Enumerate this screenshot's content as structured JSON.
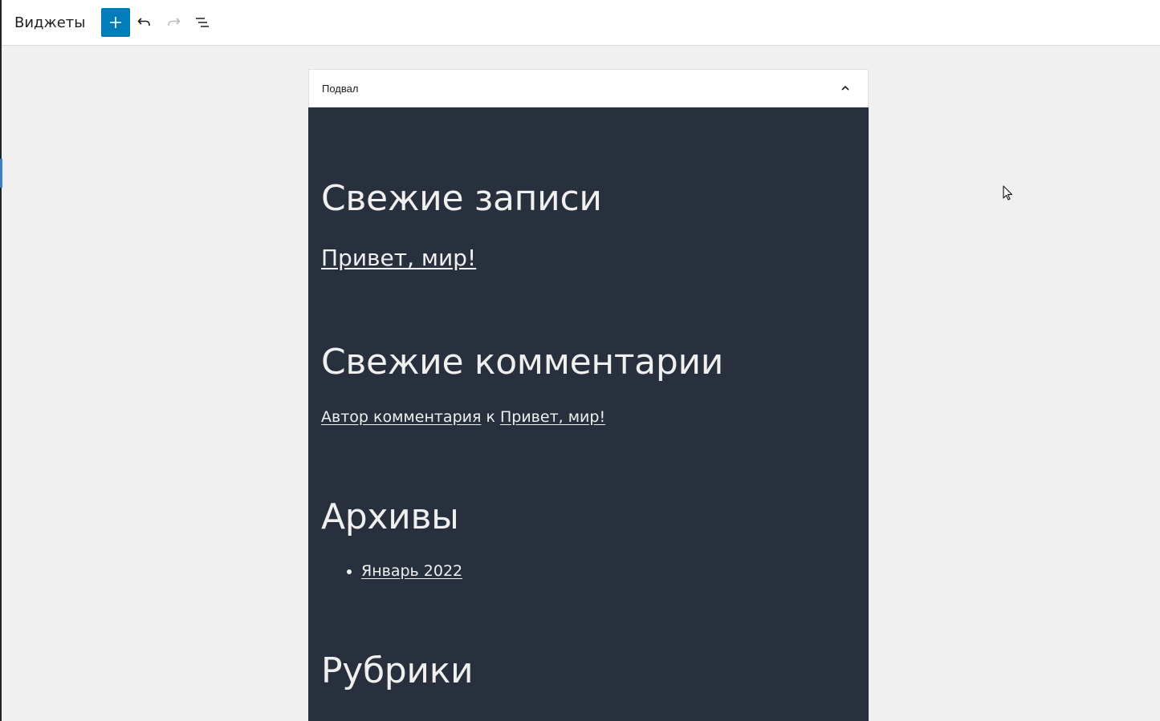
{
  "topbar": {
    "title": "Виджеты",
    "add_icon": "plus-icon",
    "undo_icon": "undo-icon",
    "redo_icon": "redo-icon",
    "list_view_icon": "list-view-icon"
  },
  "widget_area": {
    "label": "Подвал",
    "toggle_icon": "chevron-up-icon",
    "background": "#282f3d"
  },
  "widgets": {
    "recent_posts": {
      "title": "Свежие записи",
      "items": [
        "Привет, мир!"
      ]
    },
    "recent_comments": {
      "title": "Свежие комментарии",
      "author": "Автор комментария",
      "connector": " к ",
      "post": "Привет, мир!"
    },
    "archives": {
      "title": "Архивы",
      "items": [
        "Январь 2022"
      ]
    },
    "categories": {
      "title": "Рубрики"
    }
  },
  "colors": {
    "accent": "#007cba",
    "text_on_dark": "#f0f0f0"
  }
}
